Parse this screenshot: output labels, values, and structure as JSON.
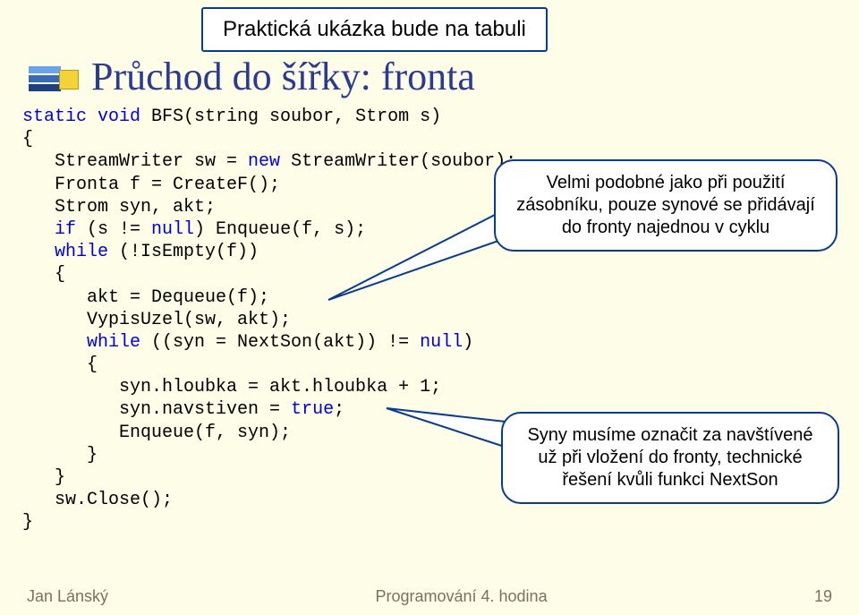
{
  "banner": "Praktická ukázka bude na tabuli",
  "title": "Průchod do šířky: fronta",
  "code": {
    "l01a": "static",
    "l01b": " void",
    "l01c": " BFS(string soubor, Strom s)",
    "l02": "{",
    "l03a": "   StreamWriter sw = ",
    "l03b": "new",
    "l03c": " StreamWriter(soubor);",
    "l04": "   Fronta f = CreateF();",
    "l05": "   Strom syn, akt;",
    "l06a": "   if",
    "l06b": " (s != ",
    "l06c": "null",
    "l06d": ") Enqueue(f, s);",
    "l07a": "   while",
    "l07b": " (!IsEmpty(f))",
    "l08": "   {",
    "l09": "      akt = Dequeue(f);",
    "l10": "      VypisUzel(sw, akt);",
    "l11a": "      while",
    "l11b": " ((syn = NextSon(akt)) != ",
    "l11c": "null",
    "l11d": ")",
    "l12": "      {",
    "l13": "         syn.hloubka = akt.hloubka + 1;",
    "l14a": "         syn.navstiven = ",
    "l14b": "true",
    "l14c": ";",
    "l15": "         Enqueue(f, syn);",
    "l16": "      }",
    "l17": "   }",
    "l18": "   sw.Close();",
    "l19": "}"
  },
  "callout1": {
    "line1": "Velmi podobné jako při použití",
    "line2": "zásobníku, pouze synové se přidávají",
    "line3": "do fronty najednou v cyklu"
  },
  "callout2": {
    "line1": "Syny musíme označit za navštívené",
    "line2": "už při vložení do fronty, technické",
    "line3": "řešení kvůli funkci NextSon"
  },
  "footer": {
    "author": "Jan Lánský",
    "center": "Programování 4. hodina",
    "page": "19"
  }
}
